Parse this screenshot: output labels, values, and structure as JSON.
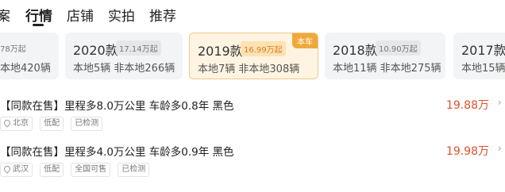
{
  "tabs": [
    {
      "label": "案",
      "active": false
    },
    {
      "label": "行情",
      "active": true
    },
    {
      "label": "店铺",
      "active": false
    },
    {
      "label": "实拍",
      "active": false
    },
    {
      "label": "推荐",
      "active": false
    }
  ],
  "year_cards": [
    {
      "year": "",
      "price": "78万起",
      "counts": "本地420辆",
      "selected": false,
      "tag": ""
    },
    {
      "year": "2020款",
      "price": "17.14万起",
      "counts": "本地5辆 非本地266辆",
      "selected": false,
      "tag": ""
    },
    {
      "year": "2019款",
      "price": "16.99万起",
      "counts": "本地7辆 非本地308辆",
      "selected": true,
      "tag": "本车"
    },
    {
      "year": "2018款",
      "price": "10.90万起",
      "counts": "本地11辆 非本地275辆",
      "selected": false,
      "tag": ""
    },
    {
      "year": "2017款",
      "price": "",
      "counts": "本地15辆",
      "selected": false,
      "tag": ""
    }
  ],
  "listings": [
    {
      "title": "【同款在售】里程多8.0万公里 车龄多0.8年 黑色",
      "price": "19.88万",
      "chevron": "›",
      "chips": [
        "北京",
        "低配",
        "已检测"
      ]
    },
    {
      "title": "【同款在售】里程多4.0万公里 车龄多0.9年 黑色",
      "price": "19.98万",
      "chevron": "›",
      "chips": [
        "武汉",
        "低配",
        "全国可售",
        "已检测"
      ]
    }
  ],
  "colors": {
    "accent": "#f0a83a",
    "price": "#e0502c",
    "selected_bg": "#fff4e2"
  }
}
